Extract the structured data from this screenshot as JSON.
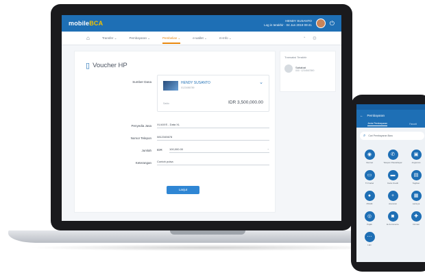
{
  "app": {
    "logo": "mobile",
    "logo_accent": "BCA",
    "header": {
      "user_name": "HENDY SUSANTO",
      "user_sub": "Log in terakhir · 04 Jun 2019 09:41",
      "power_icon": "power-icon"
    }
  },
  "nav": {
    "home_icon": "home-icon",
    "items": [
      {
        "label": "Transfer ⌄"
      },
      {
        "label": "Pembayaran ⌄"
      },
      {
        "label": "Pembelian ⌄"
      },
      {
        "label": "e-wallet ⌄"
      },
      {
        "label": "m-Info ⌄"
      }
    ],
    "active_index": 2,
    "right_icons": [
      "bell-icon",
      "settings-icon"
    ]
  },
  "form": {
    "title": "Voucher HP",
    "source_label": "Sumber Dana",
    "account": {
      "name": "HENDY SUSANTO",
      "number": "0123456789",
      "saldo_label": "Saldo",
      "balance": "IDR 3,500,000.00"
    },
    "provider_label": "Penyedia Jasa",
    "provider_value": "XL/AXIS - Data XL",
    "phone_label": "Nomor Telepon",
    "phone_value": "0812345678",
    "amount_label": "Jumlah",
    "currency": "IDR",
    "amount_value": "100,000.00",
    "note_label": "Keterangan",
    "note_value": "Contoh pulsa",
    "submit_label": "Lanjut"
  },
  "side": {
    "title": "Transaksi Terakhir",
    "item_name": "Sahabat",
    "item_sub": "000 ·1234567890"
  },
  "phone": {
    "title": "Pembayaran",
    "tabs": [
      "Jenis Pembayaran",
      "Favorit"
    ],
    "search_placeholder": "Cari Pembayaran Baru",
    "items": [
      {
        "icon": "wifi-icon",
        "label": "Internet"
      },
      {
        "icon": "phone-icon",
        "label": "Telepon Pascabayar"
      },
      {
        "icon": "wallet-icon",
        "label": "Angsuran"
      },
      {
        "icon": "tv-icon",
        "label": "TV Kabel"
      },
      {
        "icon": "card-icon",
        "label": "Kartu Kredit"
      },
      {
        "icon": "doc-icon",
        "label": "Tagihan"
      },
      {
        "icon": "water-icon",
        "label": "PDAM"
      },
      {
        "icon": "plus-icon",
        "label": "Asuransi"
      },
      {
        "icon": "building-icon",
        "label": "Lainnya"
      },
      {
        "icon": "school-icon",
        "label": "Pajak"
      },
      {
        "icon": "bag-icon",
        "label": "E-Commerce"
      },
      {
        "icon": "gift-icon",
        "label": "Donasi"
      },
      {
        "icon": "more-icon",
        "label": "Lain"
      }
    ]
  },
  "colors": {
    "primary": "#1e6fb5",
    "accent": "#e8870e",
    "button": "#2f86d4"
  }
}
